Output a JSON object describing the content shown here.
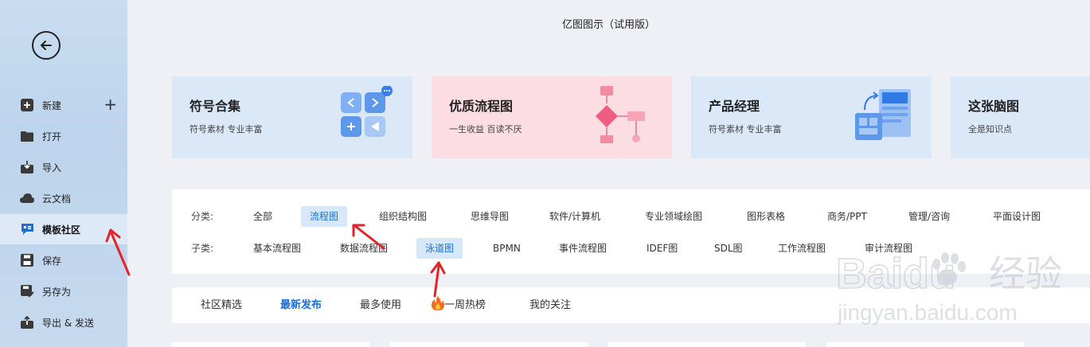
{
  "app": {
    "title": "亿图图示（试用版）"
  },
  "sidebar": {
    "items": [
      {
        "label": "新建",
        "icon": "plus-square-icon"
      },
      {
        "label": "打开",
        "icon": "folder-icon"
      },
      {
        "label": "导入",
        "icon": "import-icon"
      },
      {
        "label": "云文档",
        "icon": "cloud-icon"
      },
      {
        "label": "模板社区",
        "icon": "community-icon",
        "active": true
      },
      {
        "label": "保存",
        "icon": "save-icon"
      },
      {
        "label": "另存为",
        "icon": "save-as-icon"
      },
      {
        "label": "导出 & 发送",
        "icon": "export-icon"
      }
    ],
    "new_plus": "+"
  },
  "cards": [
    {
      "title": "符号合集",
      "subtitle": "符号素材 专业丰富",
      "bg": "#dbe8f8"
    },
    {
      "title": "优质流程图",
      "subtitle": "一生收益 百读不厌",
      "bg": "#fbdde3"
    },
    {
      "title": "产品经理",
      "subtitle": "符号素材 专业丰富",
      "bg": "#dbe8f8"
    },
    {
      "title": "这张脑图",
      "subtitle": "全是知识点",
      "bg": "#dbe8f8"
    }
  ],
  "category": {
    "label": "分类:",
    "items": [
      "全部",
      "流程图",
      "组织结构图",
      "思维导图",
      "软件/计算机",
      "专业领域绘图",
      "图形表格",
      "商务/PPT",
      "管理/咨询",
      "平面设计图"
    ],
    "selected": "流程图"
  },
  "subcategory": {
    "label": "子类:",
    "items": [
      "基本流程图",
      "数据流程图",
      "泳道图",
      "BPMN",
      "事件流程图",
      "IDEF图",
      "SDL图",
      "工作流程图",
      "审计流程图"
    ],
    "selected": "泳道图"
  },
  "tabs": {
    "items": [
      "社区精选",
      "最新发布",
      "最多使用",
      "一周热榜",
      "我的关注"
    ],
    "selected": "最新发布"
  },
  "watermark": {
    "brand": "Baidu",
    "cn": "经验",
    "url": "jingyan.baidu.com"
  },
  "colors": {
    "accent": "#1a6fd6",
    "arrow": "#e0242a"
  }
}
